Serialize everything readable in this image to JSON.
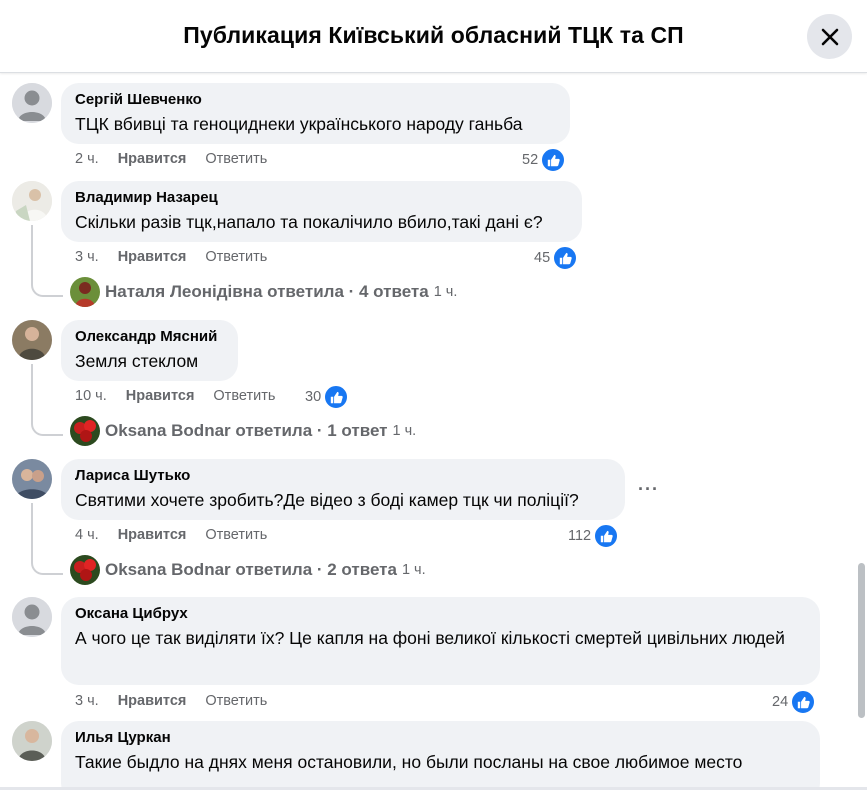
{
  "header": {
    "title": "Публикация Київський обласний ТЦК та СП"
  },
  "comments": [
    {
      "author": "Сергій Шевченко",
      "text": "ТЦК вбивці та геноциднеки українського народу ганьба",
      "time": "2 ч.",
      "like_label": "Нравится",
      "reply_label": "Ответить",
      "reactions": "52",
      "avatar": "default-avatar"
    },
    {
      "author": "Владимир Назарец",
      "text": "Скільки разів тцк,напало та покалічило вбило,такі дані є?",
      "time": "3 ч.",
      "like_label": "Нравится",
      "reply_label": "Ответить",
      "reactions": "45",
      "avatar": "photo-avatar",
      "reply_summary": {
        "text": "Наталя Леонідівна ответила · 4 ответа",
        "time": "1 ч."
      }
    },
    {
      "author": "Олександр Мясний",
      "text": "Земля стеклом",
      "time": "10 ч.",
      "like_label": "Нравится",
      "reply_label": "Ответить",
      "reactions": "30",
      "avatar": "photo-avatar",
      "reply_summary": {
        "text": "Oksana Bodnar ответила · 1 ответ",
        "time": "1 ч."
      }
    },
    {
      "author": "Лариса Шутько",
      "text": "Святими хочете зробить?Де відео з боді камер тцк чи поліції?",
      "time": "4 ч.",
      "like_label": "Нравится",
      "reply_label": "Ответить",
      "reactions": "112",
      "avatar": "photo-avatar",
      "more": "···",
      "reply_summary": {
        "text": "Oksana Bodnar ответила · 2 ответа",
        "time": "1 ч."
      }
    },
    {
      "author": "Оксана Цибрух",
      "text": "А чого це так виділяти їх? Це капля на фоні великої кількості смертей цивільних людей",
      "time": "3 ч.",
      "like_label": "Нравится",
      "reply_label": "Ответить",
      "reactions": "24",
      "avatar": "default-avatar"
    },
    {
      "author": "Илья Цуркан",
      "text": "Такие быдло на днях меня остановили, но были посланы на свое любимое место",
      "avatar": "photo-avatar"
    }
  ],
  "colors": {
    "accent": "#1877f2",
    "bubble": "#f0f2f5",
    "muted": "#65676b"
  }
}
